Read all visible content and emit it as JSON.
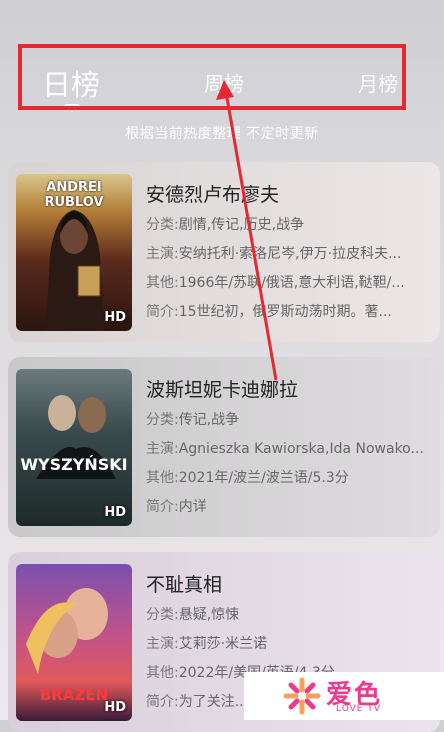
{
  "tabs": {
    "day": "日榜",
    "week": "周榜",
    "month": "月榜"
  },
  "subtitle": "根据当前热度整理 不定时更新",
  "labels": {
    "category": "分类:",
    "cast": "主演:",
    "other": "其他:",
    "intro": "简介:",
    "hd": "HD"
  },
  "movies": [
    {
      "title": "安德烈卢布廖夫",
      "poster_title": "ANDREI RUBLOV",
      "category": "剧情,传记,历史,战争",
      "cast": "安纳托利·索洛尼岑,伊万·拉皮科夫...",
      "other": "1966年/苏联/俄语,意大利语,鞑靼/...",
      "intro": "15世纪初，俄罗斯动荡时期。著..."
    },
    {
      "title": "波斯坦妮卡迪娜拉",
      "poster_title": "WYSZYŃSKI",
      "category": "传记,战争",
      "cast": "Agnieszka Kawiorska,Ida Nowako...",
      "other": "2021年/波兰/波兰语/5.3分",
      "intro": "内详"
    },
    {
      "title": "不耻真相",
      "poster_title": "BRAZEN",
      "category": "悬疑,惊悚",
      "cast": "艾莉莎·米兰诺",
      "other": "2022年/美国/英语/4.3分",
      "intro": "为了关注..."
    }
  ],
  "watermark": {
    "name": "爱色",
    "sub": "LOVE TV"
  },
  "colors": {
    "highlight": "#e32a32",
    "brand": "#ee3a8a"
  }
}
